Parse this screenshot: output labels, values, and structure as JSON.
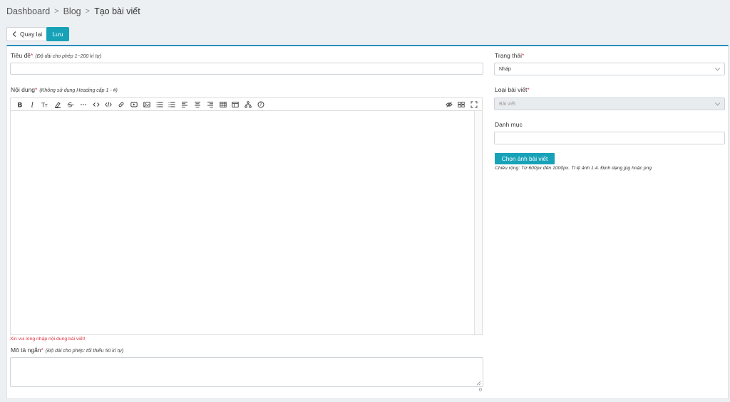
{
  "breadcrumb": {
    "items": [
      "Dashboard",
      "Blog"
    ],
    "current": "Tạo bài viết"
  },
  "actions": {
    "back_label": "Quay lại",
    "save_label": "Lưu",
    "accent": "#17a2b8"
  },
  "form": {
    "title": {
      "label": "Tiêu đề",
      "required": "*",
      "hint": "(Độ dài cho phép 1~200 kí tự)",
      "value": ""
    },
    "content": {
      "label": "Nội dung",
      "required": "*",
      "hint": "(Không sử dụng Heading cấp 1 - #)",
      "value": "",
      "error": "Xin vui lòng nhập nội dung bài viết!",
      "toolbar_icons": [
        "bold-icon",
        "italic-icon",
        "text-size-icon",
        "highlight-icon",
        "strikethrough-icon",
        "more-icon",
        "code-icon",
        "code-block-icon",
        "link-icon",
        "video-icon",
        "image-icon",
        "unordered-list-icon",
        "ordered-list-icon",
        "align-left-icon",
        "align-center-icon",
        "align-right-icon",
        "table-icon",
        "template-icon",
        "diagram-icon",
        "help-icon"
      ],
      "toolbar_right_icons": [
        "preview-icon",
        "side-by-side-icon",
        "fullscreen-icon"
      ]
    },
    "summary": {
      "label": "Mô tả ngắn",
      "required": "*",
      "hint": "(Độ dài cho phép: tối thiểu 50 kí tự)",
      "value": "",
      "counter": "0"
    },
    "status": {
      "label": "Trạng thái",
      "required": "*",
      "value": "Nháp"
    },
    "post_type": {
      "label": "Loại bài viết",
      "required": "*",
      "value": "Bài viết"
    },
    "category": {
      "label": "Danh mục",
      "value": ""
    },
    "image": {
      "button_label": "Chọn ảnh bài viết",
      "hint": "Chiều rộng: Từ 600px đến 1000px. Tỉ lệ ảnh 1.4. Định dạng jpg hoặc png"
    }
  }
}
